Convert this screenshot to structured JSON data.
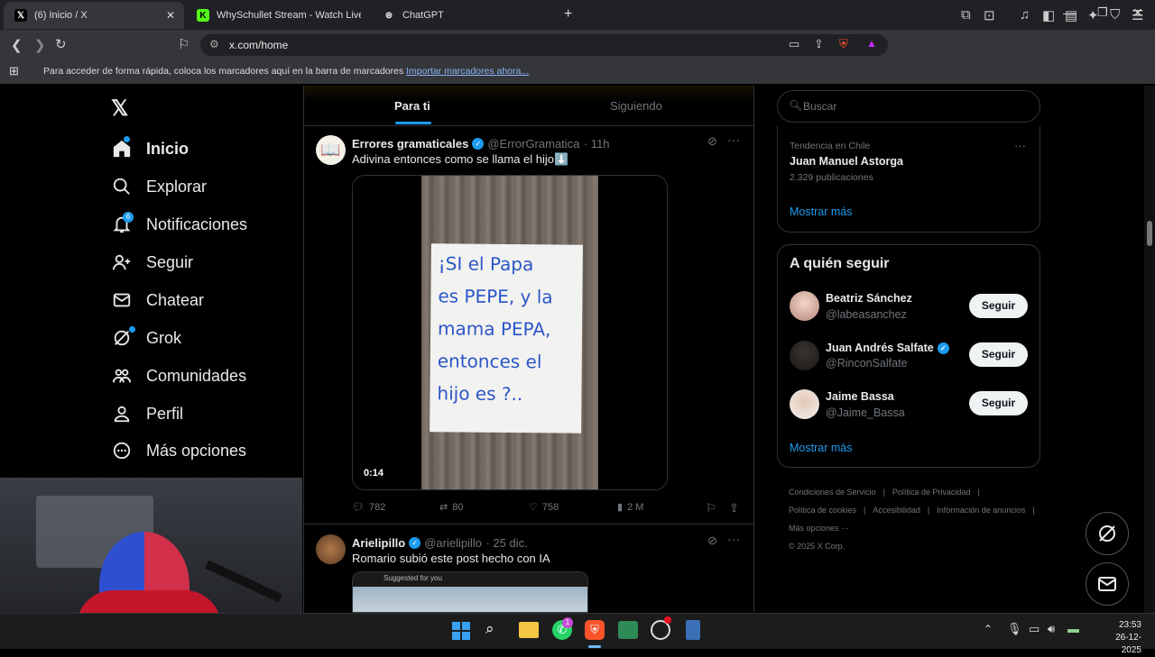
{
  "browser": {
    "tabs": [
      {
        "title": "(6) Inicio / X"
      },
      {
        "title": "WhySchullet Stream - Watch Live on"
      },
      {
        "title": "ChatGPT"
      }
    ],
    "url": "x.com/home",
    "bookmarks_text": "Para acceder de forma rápida, coloca los marcadores aquí en la barra de marcadores",
    "bookmarks_link": "Importar marcadores ahora..."
  },
  "sidebar": {
    "items": [
      {
        "label": "Inicio",
        "icon": "home-icon"
      },
      {
        "label": "Explorar",
        "icon": "search-icon"
      },
      {
        "label": "Notificaciones",
        "icon": "bell-icon",
        "badge": "6"
      },
      {
        "label": "Seguir",
        "icon": "add-user-icon"
      },
      {
        "label": "Chatear",
        "icon": "mail-icon"
      },
      {
        "label": "Grok",
        "icon": "grok-icon"
      },
      {
        "label": "Comunidades",
        "icon": "people-icon"
      },
      {
        "label": "Perfil",
        "icon": "person-icon"
      },
      {
        "label": "Más opciones",
        "icon": "more-icon"
      }
    ]
  },
  "feed": {
    "tabs": [
      "Para ti",
      "Siguiendo"
    ],
    "tweets": [
      {
        "name": "Errores gramaticales",
        "handle": "@ErrorGramatica",
        "time": "· 11h",
        "text": "Adivina entonces como se llama el hijo⬇️",
        "note": [
          "¡SI el Papa",
          "es PEPE, y la",
          "mama PEPA,",
          "entonces el",
          "hijo es ?.."
        ],
        "duration": "0:14",
        "replies": "782",
        "retweets": "80",
        "likes": "758",
        "views": "2 M"
      },
      {
        "name": "Arielipillo",
        "handle": "@arielipillo",
        "time": "· 25 dic.",
        "text": "Romario subió este post hecho con IA",
        "inner": "Suggested for you"
      }
    ]
  },
  "right": {
    "search_placeholder": "Buscar",
    "trend_category": "Tendencia en Chile",
    "trend_name": "Juan Manuel Astorga",
    "trend_count": "2.329 publicaciones",
    "show_more": "Mostrar más",
    "who_title": "A quién seguir",
    "suggestions": [
      {
        "name": "Beatriz Sánchez",
        "handle": "@labeasanchez",
        "button": "Seguir"
      },
      {
        "name": "Juan Andrés Salfate",
        "handle": "@RinconSalfate",
        "button": "Seguir"
      },
      {
        "name": "Jaime Bassa",
        "handle": "@Jaime_Bassa",
        "button": "Seguir"
      }
    ],
    "show_more2": "Mostrar más",
    "footer": [
      "Condiciones de Servicio",
      "|",
      "Política de Privacidad",
      "|",
      "Política de cookies",
      "|",
      "Accesibilidad",
      "|",
      "Información de anuncios",
      "|",
      "Más opciones ···",
      "© 2025 X Corp."
    ]
  },
  "taskbar": {
    "time": "23:53",
    "date": "26-12-2025",
    "whatsapp_badge": "1"
  },
  "colors": {
    "accent": "#1d9bf0",
    "bg": "#000000"
  }
}
